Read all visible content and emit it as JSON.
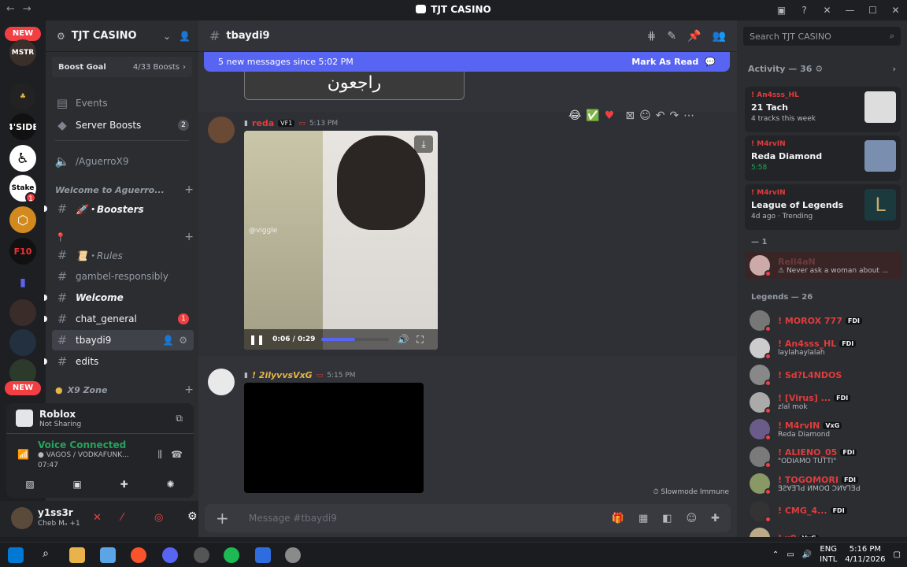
{
  "window": {
    "title": "TJT CASINO",
    "back": "←",
    "forward": "→"
  },
  "rail": {
    "new_top": "NEW",
    "new_bottom": "NEW",
    "badge": "1",
    "badge2": "1"
  },
  "server": {
    "name": "TJT CASINO",
    "boost_goal": "Boost Goal",
    "boost_count": "4/33 Boosts",
    "events": "Events",
    "server_boosts": "Server Boosts",
    "server_boosts_count": "2",
    "voice_channel": "/AguerroX9",
    "category_welcome": "Welcome to Aguerro...",
    "ch_boosters": "🚀・Boosters",
    "category_pin": "📍",
    "ch_rules": "📜・Rules",
    "ch_gamble": "gambel-responsibly",
    "ch_welcome": "Welcome",
    "ch_chat": "chat_general",
    "ch_chat_count": "1",
    "ch_tbaydi": "tbaydi9",
    "ch_edits": "edits",
    "category_x9": "X9 Zone"
  },
  "activity_panel": {
    "game": "Roblox",
    "game_status": "Not Sharing",
    "voice_title": "Voice Connected",
    "voice_channel": "VAGOS / VODKAFUNK...",
    "voice_time": "07:47"
  },
  "user": {
    "name": "y1ss3r",
    "status": "Cheb Mₒ +1"
  },
  "channel": {
    "name": "tbaydi9",
    "new_messages": "5 new messages since 5:02 PM",
    "mark_as_read": "Mark As Read",
    "arabic_caption": "راجعون"
  },
  "messages": [
    {
      "author": "reda",
      "tag": "VF1",
      "time": "5:13 PM",
      "video_time": "0:06 / 0:29",
      "progress": 0.5,
      "watermark": "@viggle"
    },
    {
      "author": "! 2ilyvvsVxG",
      "time": "5:15 PM"
    }
  ],
  "slowmode": "Slowmode Immune",
  "composer": {
    "placeholder": "Message #tbaydi9"
  },
  "search": {
    "placeholder": "Search TJT CASINO"
  },
  "right_panel": {
    "activity_header": "Activity — 36",
    "cards": [
      {
        "user": "! An4sss_HL",
        "title": "21 Tach",
        "sub": "4 tracks this week"
      },
      {
        "user": "! M4rvIN",
        "title": "Reda Diamond",
        "sub": "5:58"
      },
      {
        "user": "! M4rvIN",
        "title": "League of Legends",
        "sub": "4d ago · Trending"
      }
    ],
    "section1": "— 1",
    "member_special": {
      "name": "Rell4aN",
      "status": "Never ask a woman about ..."
    },
    "section2": "Legends — 26",
    "members": [
      {
        "name": "! MOROX 777",
        "tag": "FDI",
        "status": ""
      },
      {
        "name": "! An4sss_HL",
        "tag": "FDI",
        "status": "laylahaylalah"
      },
      {
        "name": "! Sd?L4NDOS",
        "tag": "",
        "status": ""
      },
      {
        "name": "! [Virus] ...",
        "tag": "FDI",
        "status": "zlal mok"
      },
      {
        "name": "! M4rvIN",
        "tag": "VxG",
        "status": "Reda Diamond"
      },
      {
        "name": "! ALIENO_05",
        "tag": "FDI",
        "status": "\"ODIAMO TUTTI\""
      },
      {
        "name": "! TOGOMORI",
        "tag": "FDI",
        "status": "ƎƧ∀ƎꞀԀ ИMOᗡ ƆИ∀ꞀƎԀ"
      },
      {
        "name": "! CMG_4...",
        "tag": "FDI",
        "status": ""
      },
      {
        "name": "! x9",
        "tag": "VxG",
        "status": ""
      }
    ]
  },
  "taskbar": {
    "lang": "ENG",
    "layout": "INTL",
    "time": "5:16 PM",
    "date": "4/11/2026"
  },
  "colors": {
    "blurple": "#5865f2",
    "red": "#f23f43",
    "bg": "#313338"
  }
}
